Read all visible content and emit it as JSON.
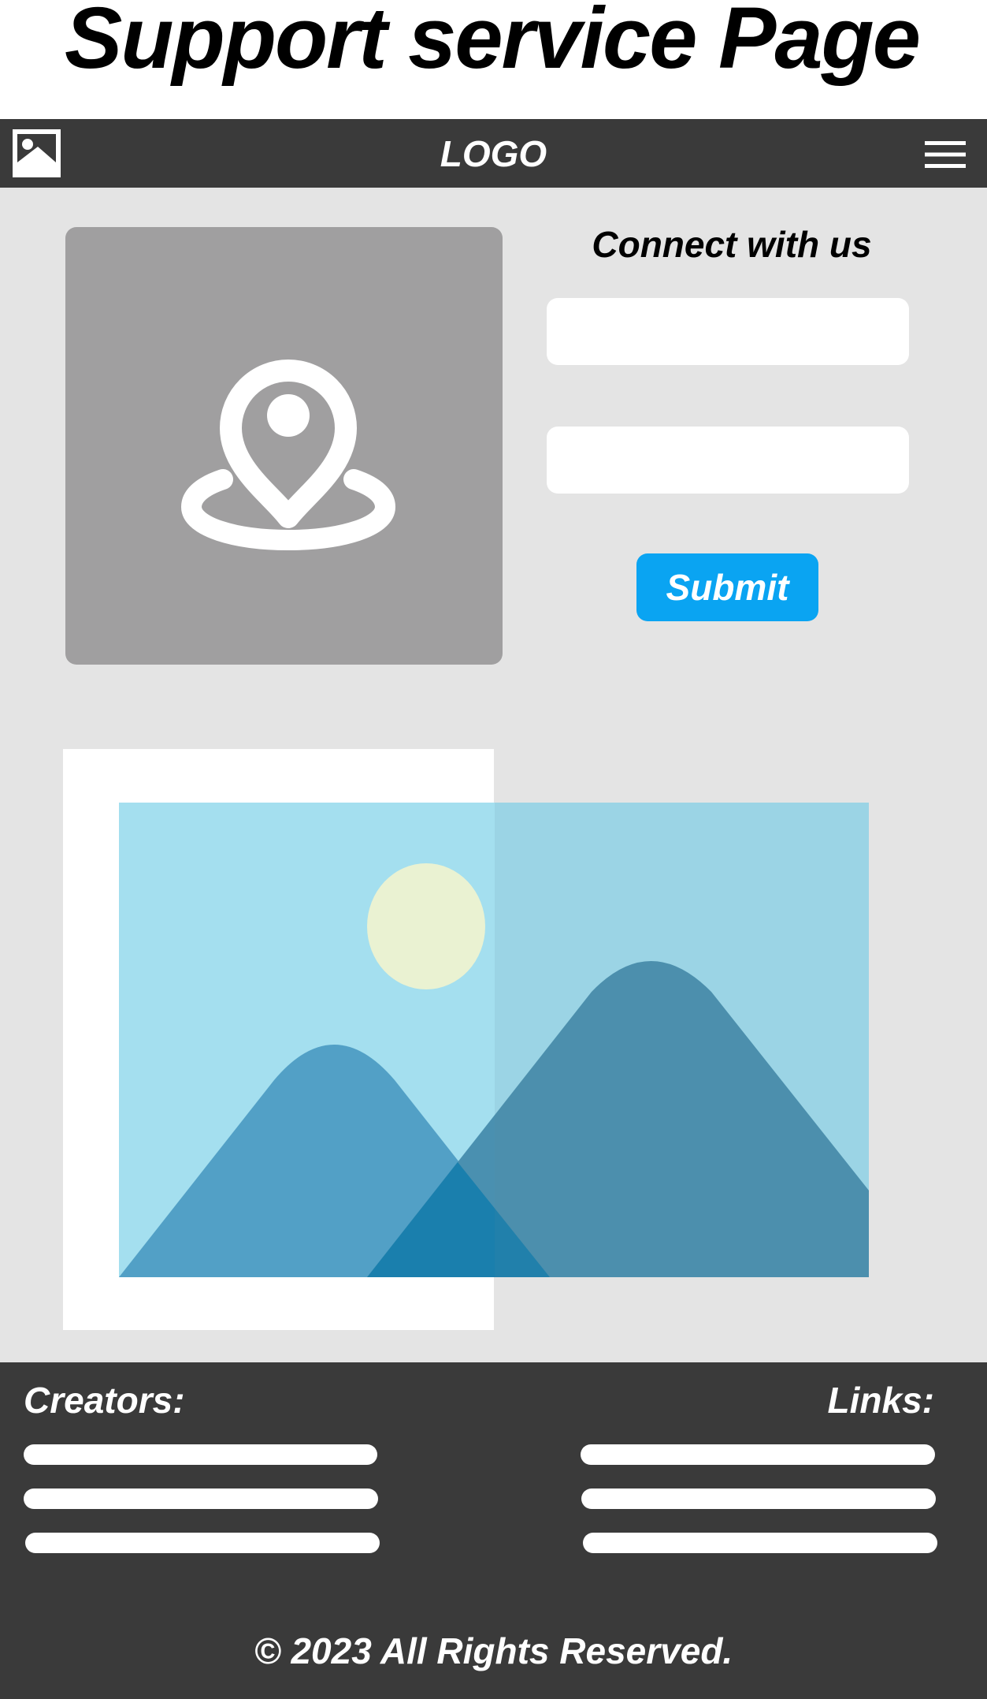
{
  "page": {
    "title": "Support service Page"
  },
  "navbar": {
    "logo": "LOGO",
    "left_icon": "image-icon",
    "right_icon": "hamburger-menu-icon"
  },
  "contact": {
    "heading": "Connect with us",
    "field_1": {
      "value": "",
      "placeholder": ""
    },
    "field_2": {
      "value": "",
      "placeholder": ""
    },
    "submit_label": "Submit",
    "map_icon": "location-pin-icon"
  },
  "hero": {
    "icon": "landscape-image-icon"
  },
  "footer": {
    "creators_heading": "Creators:",
    "links_heading": "Links:",
    "copyright": "© 2023 All Rights Reserved."
  },
  "colors": {
    "dark_bar": "#3a3a3a",
    "content_background": "#e4e4e4",
    "map_card": "#a09fa0",
    "accent": "#0aa4f2",
    "sky": "#a4dfef",
    "mountain": "#4a90b0",
    "sun": "#eaf2d2"
  }
}
